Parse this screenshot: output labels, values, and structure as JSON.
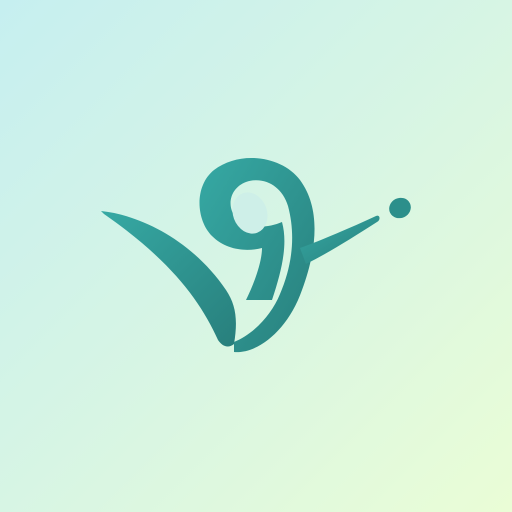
{
  "app_icon": {
    "logo": {
      "icon": "swoosh-figure-logo-icon",
      "color_primary": "#2f9c98",
      "color_dark": "#287f7c"
    },
    "background": {
      "color_start": "#c6eff0",
      "color_end": "#eafdd6"
    }
  }
}
